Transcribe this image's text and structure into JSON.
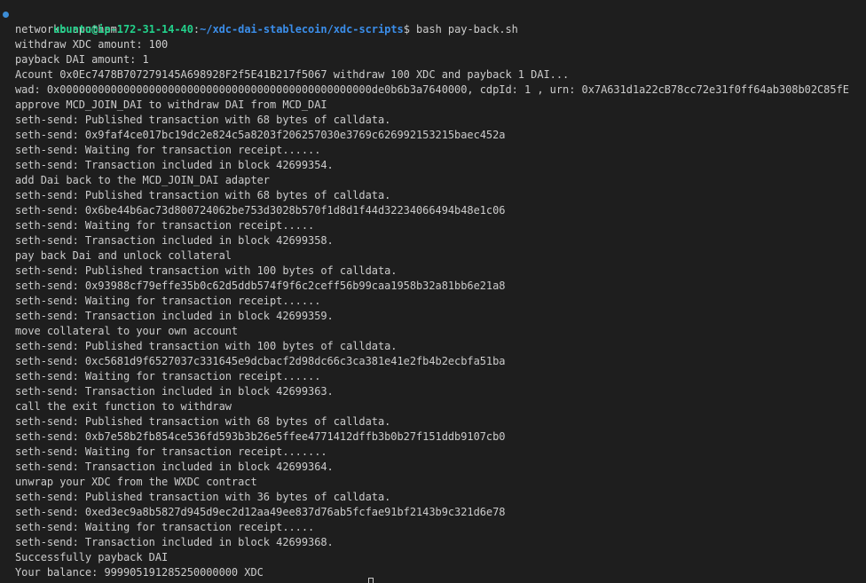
{
  "prompt": {
    "user_host": "ubuntu@ip-172-31-14-40",
    "separator": ":",
    "path": "~/xdc-dai-stablecoin/xdc-scripts",
    "symbol": "$",
    "command": " bash pay-back.sh"
  },
  "output": [
    "network: apothem",
    "withdraw XDC amount: 100",
    "payback DAI amount: 1",
    "Acount 0x0Ec7478B707279145A698928F2f5E41B217f5067 withdraw 100 XDC and payback 1 DAI...",
    "wad: 0x0000000000000000000000000000000000000000000000000de0b6b3a7640000, cdpId: 1 , urn: 0x7A631d1a22cB78cc72e31f0ff64ab308b02C85fE",
    "approve MCD_JOIN_DAI to withdraw DAI from MCD_DAI",
    "seth-send: Published transaction with 68 bytes of calldata.",
    "seth-send: 0x9faf4ce017bc19dc2e824c5a8203f206257030e3769c626992153215baec452a",
    "seth-send: Waiting for transaction receipt......",
    "seth-send: Transaction included in block 42699354.",
    "add Dai back to the MCD_JOIN_DAI adapter",
    "seth-send: Published transaction with 68 bytes of calldata.",
    "seth-send: 0x6be44b6ac73d800724062be753d3028b570f1d8d1f44d32234066494b48e1c06",
    "seth-send: Waiting for transaction receipt.....",
    "seth-send: Transaction included in block 42699358.",
    "pay back Dai and unlock collateral",
    "seth-send: Published transaction with 100 bytes of calldata.",
    "seth-send: 0x93988cf79effe35b0c62d5ddb574f9f6c2ceff56b99caa1958b32a81bb6e21a8",
    "seth-send: Waiting for transaction receipt......",
    "seth-send: Transaction included in block 42699359.",
    "move collateral to your own account",
    "seth-send: Published transaction with 100 bytes of calldata.",
    "seth-send: 0xc5681d9f6527037c331645e9dcbacf2d98dc66c3ca381e41e2fb4b2ecbfa51ba",
    "seth-send: Waiting for transaction receipt......",
    "seth-send: Transaction included in block 42699363.",
    "call the exit function to withdraw",
    "seth-send: Published transaction with 68 bytes of calldata.",
    "seth-send: 0xb7e58b2fb854ce536fd593b3b26e5ffee4771412dffb3b0b27f151ddb9107cb0",
    "seth-send: Waiting for transaction receipt.......",
    "seth-send: Transaction included in block 42699364.",
    "unwrap your XDC from the WXDC contract",
    "seth-send: Published transaction with 36 bytes of calldata.",
    "seth-send: 0xed3ec9a8b5827d945d9ec2d12aa49ee837d76ab5fcfae91bf2143b9c321d6e78",
    "seth-send: Waiting for transaction receipt.....",
    "seth-send: Transaction included in block 42699368.",
    "Successfully payback DAI",
    "Your balance: 999905191285250000000 XDC"
  ],
  "colors": {
    "background": "#1e1e1e",
    "text": "#cccccc",
    "user_host": "#23d18b",
    "path": "#3b8eea",
    "decoration_dot": "#3c8dd6"
  }
}
